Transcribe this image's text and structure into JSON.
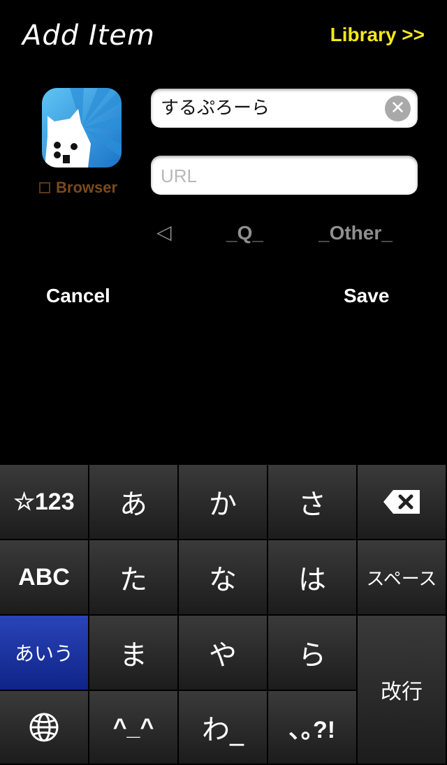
{
  "header": {
    "title": "Add Item",
    "library_link": "Library >>"
  },
  "app": {
    "icon_name": "browser-cat-icon",
    "checkbox_label": "Browser",
    "checkbox_checked": false
  },
  "fields": {
    "name_value": "するぷろーら",
    "url_placeholder": "URL"
  },
  "options": {
    "back_arrow": "◁",
    "q_label": "_Q_",
    "other_label": "_Other_"
  },
  "actions": {
    "cancel": "Cancel",
    "save": "Save"
  },
  "keyboard": {
    "row1": [
      "☆123",
      "あ",
      "か",
      "さ"
    ],
    "delete_icon": "backspace-icon",
    "row2": [
      "ABC",
      "た",
      "な",
      "は",
      "スペース"
    ],
    "row3": [
      "あいう",
      "ま",
      "や",
      "ら"
    ],
    "enter": "改行",
    "row4": [
      "^_^",
      "わ_",
      "､｡?!"
    ],
    "globe_icon": "globe-icon"
  },
  "colors": {
    "library": "#f4e81c",
    "active_key": "#1f37a8",
    "browser_label": "#7a4a1a"
  }
}
